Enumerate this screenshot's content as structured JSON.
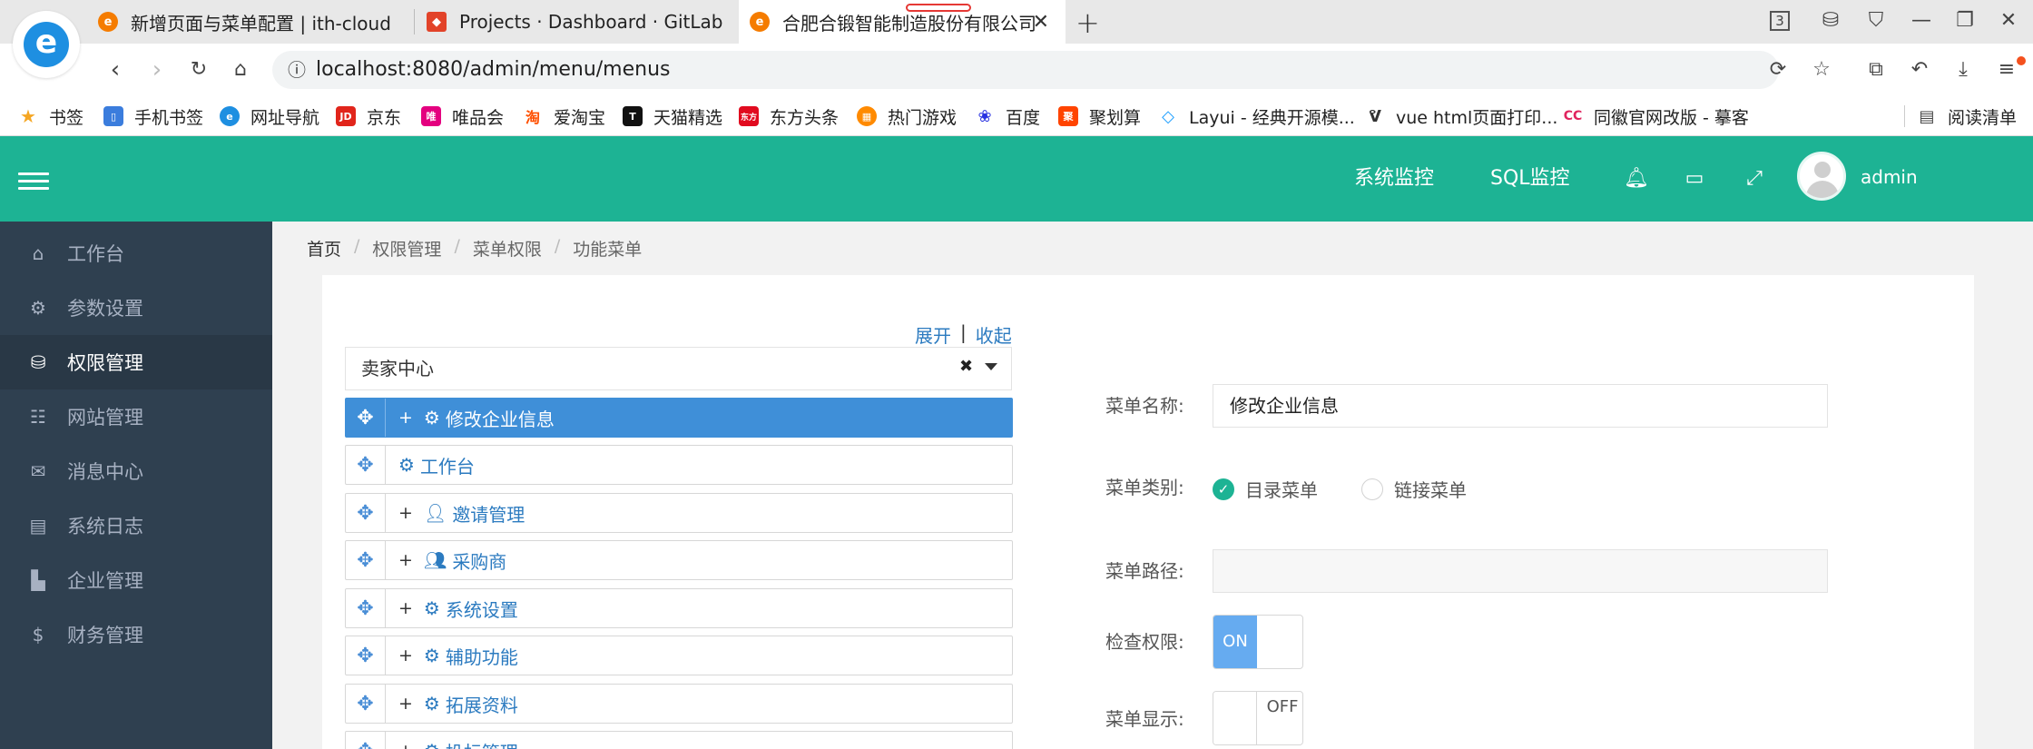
{
  "browser": {
    "tabs": [
      {
        "title": "新增页面与菜单配置 | ith-cloud"
      },
      {
        "title": "Projects · Dashboard · GitLab"
      },
      {
        "title": "合肥合锻智能制造股份有限公司"
      }
    ],
    "tab_count": "3",
    "url": "localhost:8080/admin/menu/menus",
    "bookmarks": [
      "书签",
      "手机书签",
      "网址导航",
      "京东",
      "唯品会",
      "爱淘宝",
      "天猫精选",
      "东方头条",
      "热门游戏",
      "百度",
      "聚划算",
      "Layui - 经典开源模...",
      "vue html页面打印...",
      "同徽官网改版 - 摹客"
    ],
    "reading_list": "阅读清单"
  },
  "header": {
    "nav": [
      "系统监控",
      "SQL监控"
    ],
    "user": "admin",
    "accent": "#1db394"
  },
  "sidebar": {
    "items": [
      {
        "label": "工作台",
        "icon": "home-icon"
      },
      {
        "label": "参数设置",
        "icon": "gears-icon"
      },
      {
        "label": "权限管理",
        "icon": "database-icon",
        "active": true
      },
      {
        "label": "网站管理",
        "icon": "site-icon"
      },
      {
        "label": "消息中心",
        "icon": "chat-icon"
      },
      {
        "label": "系统日志",
        "icon": "log-icon"
      },
      {
        "label": "企业管理",
        "icon": "chart-icon"
      },
      {
        "label": "财务管理",
        "icon": "dollar-icon"
      }
    ]
  },
  "breadcrumb": [
    "首页",
    "权限管理",
    "菜单权限",
    "功能菜单"
  ],
  "tree": {
    "expand": "展开",
    "separator": "|",
    "collapse": "收起",
    "select_value": "卖家中心",
    "items": [
      {
        "label": "修改企业信息",
        "expandable": true,
        "icon": "gear-icon",
        "selected": true
      },
      {
        "label": "工作台",
        "expandable": false,
        "icon": "gear-icon"
      },
      {
        "label": "邀请管理",
        "expandable": true,
        "icon": "user-icon"
      },
      {
        "label": "采购商",
        "expandable": true,
        "icon": "users-icon"
      },
      {
        "label": "系统设置",
        "expandable": true,
        "icon": "gear-icon"
      },
      {
        "label": "辅助功能",
        "expandable": true,
        "icon": "gear-icon"
      },
      {
        "label": "拓展资料",
        "expandable": true,
        "icon": "gear-icon"
      },
      {
        "label": "投标管理",
        "expandable": true,
        "icon": "gear-icon"
      }
    ]
  },
  "form": {
    "name_label": "菜单名称:",
    "name_value": "修改企业信息",
    "type_label": "菜单类别:",
    "type_options": [
      "目录菜单",
      "链接菜单"
    ],
    "type_selected": "目录菜单",
    "path_label": "菜单路径:",
    "path_value": "",
    "check_label": "检查权限:",
    "check_state": "ON",
    "display_label": "菜单显示:",
    "display_state": "OFF"
  }
}
